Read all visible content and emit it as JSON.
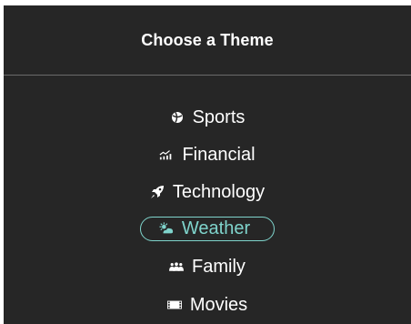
{
  "header": {
    "title": "Choose a Theme"
  },
  "themes": [
    {
      "label": "Sports",
      "icon": "ball-icon",
      "selected": false
    },
    {
      "label": "Financial",
      "icon": "chart-icon",
      "selected": false
    },
    {
      "label": "Technology",
      "icon": "rocket-icon",
      "selected": false
    },
    {
      "label": "Weather",
      "icon": "sun-cloud-icon",
      "selected": true
    },
    {
      "label": "Family",
      "icon": "people-icon",
      "selected": false
    },
    {
      "label": "Movies",
      "icon": "film-icon",
      "selected": false
    }
  ],
  "colors": {
    "background": "#262626",
    "text": "#ffffff",
    "accent": "#7fd4cc",
    "divider": "#6b6b6b"
  }
}
